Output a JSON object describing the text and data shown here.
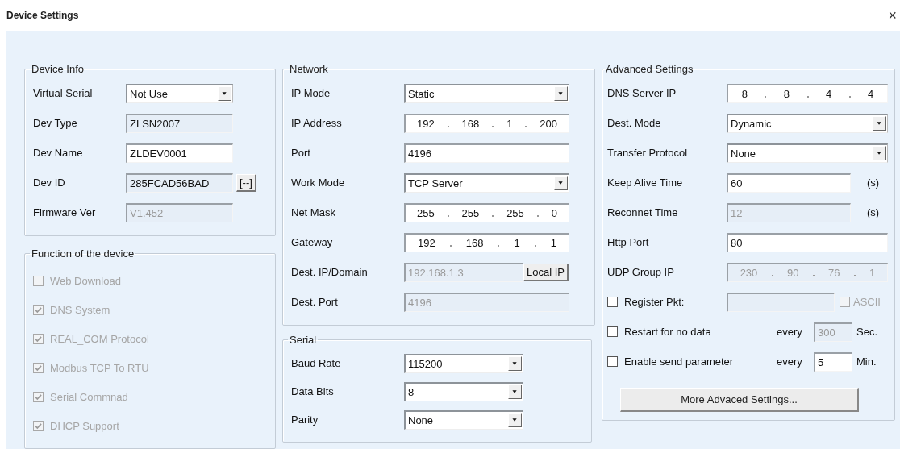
{
  "window": {
    "title": "Device Settings",
    "close": "×"
  },
  "device_info": {
    "title": "Device Info",
    "rows": [
      {
        "kind": "select",
        "label": "Virtual Serial",
        "value": "Not Use"
      },
      {
        "kind": "text",
        "label": "Dev Type",
        "value": "ZLSN2007",
        "readonly": true,
        "disabled": false
      },
      {
        "kind": "text",
        "label": "Dev Name",
        "value": "ZLDEV0001",
        "readonly": false,
        "disabled": false
      },
      {
        "kind": "text",
        "label": "Dev ID",
        "value": "285FCAD56BAD",
        "readonly": true,
        "disabled": false,
        "button": "[--]"
      },
      {
        "kind": "text",
        "label": "Firmware Ver",
        "value": "V1.452",
        "readonly": true,
        "disabled": true
      }
    ]
  },
  "functions": {
    "title": "Function of the device",
    "items": [
      {
        "label": "Web Download",
        "checked": false,
        "disabled": true
      },
      {
        "label": "DNS System",
        "checked": true,
        "disabled": true
      },
      {
        "label": "REAL_COM Protocol",
        "checked": true,
        "disabled": true
      },
      {
        "label": "Modbus TCP To RTU",
        "checked": true,
        "disabled": true
      },
      {
        "label": "Serial Commnad",
        "checked": true,
        "disabled": true
      },
      {
        "label": "DHCP Support",
        "checked": true,
        "disabled": true
      }
    ]
  },
  "network": {
    "title": "Network",
    "rows": [
      {
        "kind": "select",
        "label": "IP Mode",
        "value": "Static"
      },
      {
        "kind": "ip",
        "label": "IP Address",
        "octets": [
          "192",
          "168",
          "1",
          "200"
        ],
        "disabled": false
      },
      {
        "kind": "text",
        "label": "Port",
        "value": "4196",
        "readonly": false,
        "disabled": false
      },
      {
        "kind": "select",
        "label": "Work Mode",
        "value": "TCP Server"
      },
      {
        "kind": "ip",
        "label": "Net Mask",
        "octets": [
          "255",
          "255",
          "255",
          "0"
        ],
        "disabled": false
      },
      {
        "kind": "ip",
        "label": "Gateway",
        "octets": [
          "192",
          "168",
          "1",
          "1"
        ],
        "disabled": false
      },
      {
        "kind": "text",
        "label": "Dest. IP/Domain",
        "value": "192.168.1.3",
        "readonly": false,
        "disabled": true,
        "button": "Local IP"
      },
      {
        "kind": "text",
        "label": "Dest. Port",
        "value": "4196",
        "readonly": false,
        "disabled": true
      }
    ]
  },
  "serial": {
    "title": "Serial",
    "rows": [
      {
        "kind": "select",
        "label": "Baud Rate",
        "value": "115200"
      },
      {
        "kind": "select",
        "label": "Data Bits",
        "value": "8"
      },
      {
        "kind": "select",
        "label": "Parity",
        "value": "None"
      }
    ]
  },
  "advanced": {
    "title": "Advanced Settings",
    "rows": [
      {
        "kind": "ip",
        "label": "DNS Server IP",
        "octets": [
          "8",
          "8",
          "4",
          "4"
        ],
        "disabled": false
      },
      {
        "kind": "select",
        "label": "Dest. Mode",
        "value": "Dynamic"
      },
      {
        "kind": "select",
        "label": "Transfer Protocol",
        "value": "None"
      },
      {
        "kind": "text",
        "label": "Keep Alive Time",
        "value": "60",
        "readonly": false,
        "disabled": false,
        "unit": "(s)"
      },
      {
        "kind": "text",
        "label": "Reconnet Time",
        "value": "12",
        "readonly": false,
        "disabled": true,
        "unit": "(s)"
      },
      {
        "kind": "text",
        "label": "Http Port",
        "value": "80",
        "readonly": false,
        "disabled": false
      },
      {
        "kind": "ip",
        "label": "UDP Group IP",
        "octets": [
          "230",
          "90",
          "76",
          "1"
        ],
        "disabled": true
      },
      {
        "kind": "check_field",
        "label": "Register Pkt:",
        "checked": false,
        "field_disabled": true,
        "option": {
          "label": "ASCII",
          "checked": false,
          "disabled": true
        }
      },
      {
        "kind": "interval",
        "label": "Restart for no data",
        "checked": false,
        "every": "every",
        "value": "300",
        "disabled": true,
        "unit": "Sec."
      },
      {
        "kind": "interval",
        "label": "Enable send parameter",
        "checked": false,
        "every": "every",
        "value": "5",
        "disabled": false,
        "unit": "Min."
      }
    ],
    "button": "More Advaced Settings..."
  }
}
